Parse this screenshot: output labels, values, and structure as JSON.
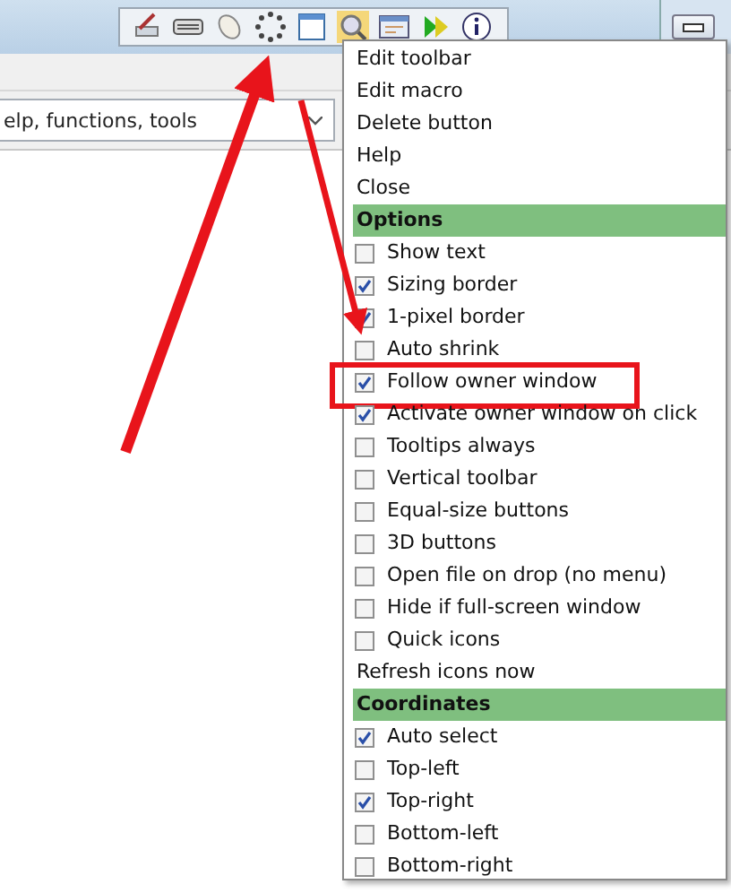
{
  "search": {
    "value": "elp, functions, tools"
  },
  "menu": {
    "items": [
      {
        "kind": "command",
        "label": "Edit toolbar"
      },
      {
        "kind": "command",
        "label": "Edit macro"
      },
      {
        "kind": "command",
        "label": "Delete button"
      },
      {
        "kind": "command",
        "label": "Help"
      },
      {
        "kind": "command",
        "label": "Close"
      },
      {
        "kind": "header",
        "label": "Options"
      },
      {
        "kind": "check",
        "label": "Show text",
        "checked": false,
        "highlighted": false
      },
      {
        "kind": "check",
        "label": "Sizing border",
        "checked": true,
        "highlighted": false
      },
      {
        "kind": "check",
        "label": "1-pixel border",
        "checked": true,
        "highlighted": false
      },
      {
        "kind": "check",
        "label": "Auto shrink",
        "checked": false,
        "highlighted": false
      },
      {
        "kind": "check",
        "label": "Follow owner window",
        "checked": true,
        "highlighted": true
      },
      {
        "kind": "check",
        "label": "Activate owner window on click",
        "checked": true,
        "highlighted": false
      },
      {
        "kind": "check",
        "label": "Tooltips always",
        "checked": false,
        "highlighted": false
      },
      {
        "kind": "check",
        "label": "Vertical toolbar",
        "checked": false,
        "highlighted": false
      },
      {
        "kind": "check",
        "label": "Equal-size buttons",
        "checked": false,
        "highlighted": false
      },
      {
        "kind": "check",
        "label": "3D buttons",
        "checked": false,
        "highlighted": false
      },
      {
        "kind": "check",
        "label": "Open file on drop (no menu)",
        "checked": false,
        "highlighted": false
      },
      {
        "kind": "check",
        "label": "Hide if full-screen window",
        "checked": false,
        "highlighted": false
      },
      {
        "kind": "check",
        "label": "Quick icons",
        "checked": false,
        "highlighted": false
      },
      {
        "kind": "command",
        "label": "Refresh icons now"
      },
      {
        "kind": "header",
        "label": "Coordinates"
      },
      {
        "kind": "check",
        "label": "Auto select",
        "checked": true,
        "highlighted": false
      },
      {
        "kind": "check",
        "label": "Top-left",
        "checked": false,
        "highlighted": false
      },
      {
        "kind": "check",
        "label": "Top-right",
        "checked": true,
        "highlighted": false
      },
      {
        "kind": "check",
        "label": "Bottom-left",
        "checked": false,
        "highlighted": false
      },
      {
        "kind": "check",
        "label": "Bottom-right",
        "checked": false,
        "highlighted": false
      }
    ]
  }
}
